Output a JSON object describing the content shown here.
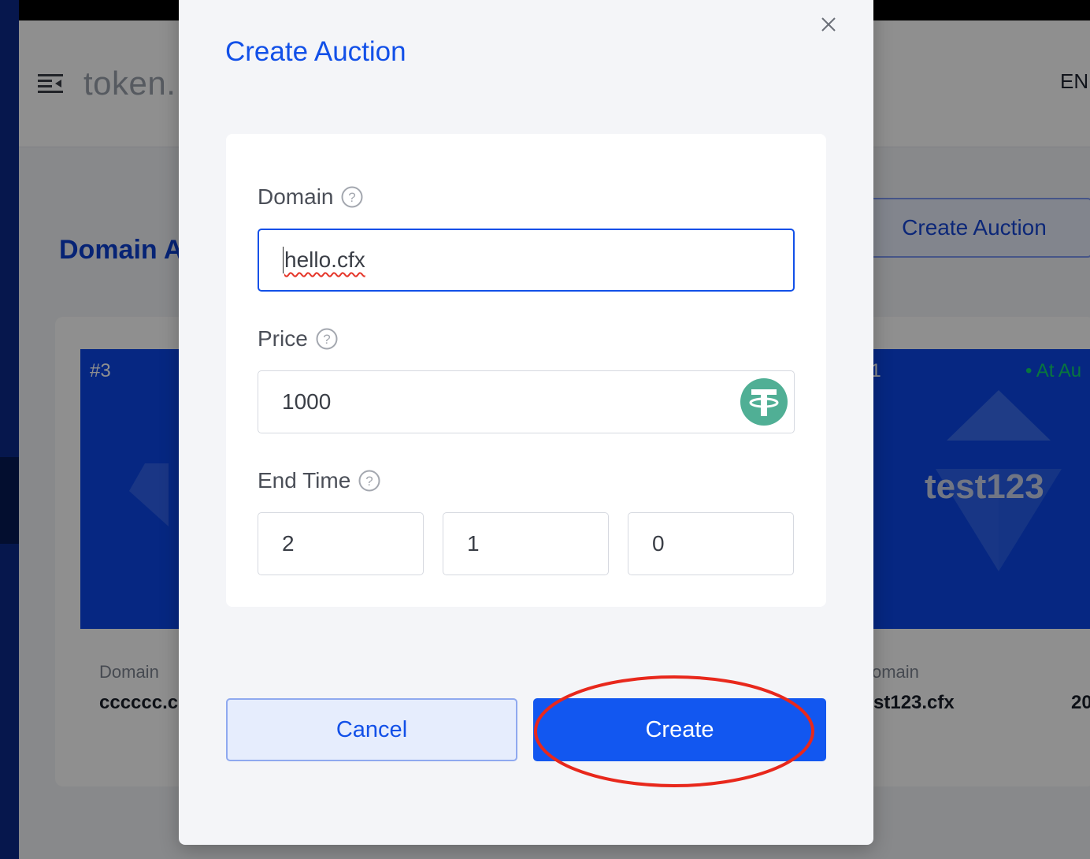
{
  "background": {
    "brand": "token.",
    "language": "EN",
    "page_title": "Domain A",
    "create_auction_button": "Create Auction",
    "cards": [
      {
        "number": "#3",
        "domain_label": "Domain",
        "domain_value": "cccccc.c"
      },
      {
        "number": "#1",
        "status": "• At Au",
        "name": "test123",
        "domain_label": "omain",
        "domain_value": "st123.cfx",
        "extra_value": "20"
      }
    ]
  },
  "modal": {
    "title": "Create Auction",
    "fields": {
      "domain": {
        "label": "Domain",
        "value": "hello.cfx"
      },
      "price": {
        "label": "Price",
        "value": "1000",
        "token_icon": "tether-usdt-icon"
      },
      "end_time": {
        "label": "End Time",
        "values": [
          "2",
          "1",
          "0"
        ]
      }
    },
    "buttons": {
      "cancel": "Cancel",
      "create": "Create"
    }
  },
  "colors": {
    "primary": "#1250e8",
    "create_button": "#1257f0",
    "highlight_ring": "#e8281c",
    "tether_green": "#50af95",
    "status_green": "#0fd36e",
    "card_blue": "#0b47e8"
  }
}
